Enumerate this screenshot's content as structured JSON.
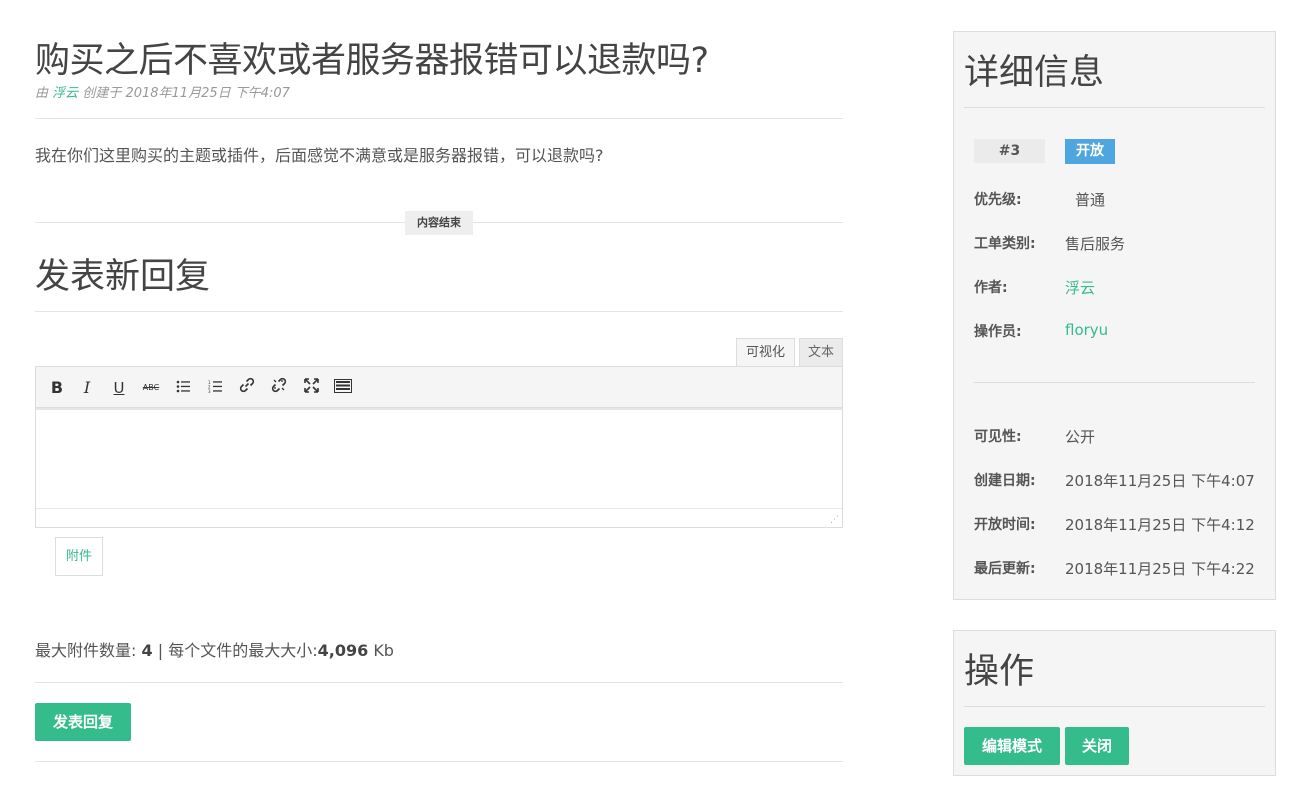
{
  "ticket": {
    "title": "购买之后不喜欢或者服务器报错可以退款吗?",
    "meta_prefix": "由",
    "author": "浮云",
    "meta_created": "创建于 2018年11月25日 下午4:07",
    "body": "我在你们这里购买的主题或插件，后面感觉不满意或是服务器报错，可以退款吗?",
    "end_label": "内容结束"
  },
  "reply": {
    "title": "发表新回复",
    "tab_visual": "可视化",
    "tab_text": "文本",
    "toolbar_icons": [
      "bold-icon",
      "italic-icon",
      "underline-icon",
      "strikethrough-icon",
      "bullet-list-icon",
      "numbered-list-icon",
      "link-icon",
      "unlink-icon",
      "fullscreen-icon",
      "toolbar-toggle-icon"
    ],
    "attach_label": "附件",
    "limit_count_label": "最大附件数量:",
    "limit_count": "4",
    "limit_sep": "| 每个文件的最大大小:",
    "limit_size": "4,096",
    "limit_unit": "Kb",
    "submit_label": "发表回复"
  },
  "details": {
    "title": "详细信息",
    "ticket_id": "#3",
    "status": "开放",
    "priority_label": "优先级:",
    "priority": "普通",
    "category_label": "工单类别:",
    "category": "售后服务",
    "author_label": "作者:",
    "author": "浮云",
    "operator_label": "操作员:",
    "operator": "floryu",
    "visibility_label": "可见性:",
    "visibility": "公开",
    "created_label": "创建日期:",
    "created": "2018年11月25日 下午4:07",
    "opened_label": "开放时间:",
    "opened": "2018年11月25日 下午4:12",
    "updated_label": "最后更新:",
    "updated": "2018年11月25日 下午4:22"
  },
  "actions": {
    "title": "操作",
    "edit_label": "编辑模式",
    "close_label": "关闭"
  },
  "colors": {
    "accent": "#35bc8d",
    "status_blue": "#4ea5e0"
  }
}
